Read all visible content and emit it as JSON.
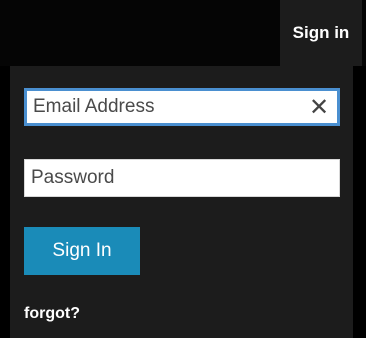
{
  "header": {
    "signin_label": "Sign in"
  },
  "form": {
    "email_placeholder": "Email Address",
    "email_value": "",
    "clear_glyph": "✕",
    "password_placeholder": "Password",
    "password_value": "",
    "submit_label": "Sign In",
    "forgot_label": "forgot?"
  },
  "icons": {
    "clear": "close-icon"
  },
  "colors": {
    "accent_button": "#1a8bb8",
    "focus_border": "#4a8fd0",
    "panel_bg": "#1c1c1c",
    "page_bg": "#000000"
  }
}
